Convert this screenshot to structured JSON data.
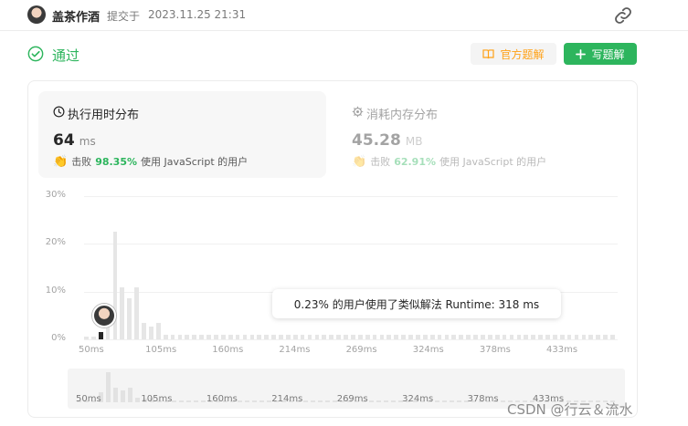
{
  "header": {
    "author": "盖茶作酒",
    "submit_label": "提交于",
    "submit_time": "2023.11.25 21:31"
  },
  "status": {
    "text": "通过",
    "color": "#2db55d"
  },
  "buttons": {
    "official_solution": "官方题解",
    "write_solution": "写题解"
  },
  "runtime": {
    "title": "执行用时分布",
    "value": "64",
    "unit": "ms",
    "beat_label": "击败",
    "beat_pct": "98.35%",
    "beat_suffix": "使用 JavaScript 的用户"
  },
  "memory": {
    "title": "消耗内存分布",
    "value": "45.28",
    "unit": "MB",
    "beat_label": "击败",
    "beat_pct": "62.91%",
    "beat_suffix": "使用 JavaScript 的用户"
  },
  "tooltip": "0.23% 的用户使用了类似解法 Runtime: 318 ms",
  "watermark": "CSDN @行云＆流水",
  "chart_data": {
    "type": "bar",
    "ylim": [
      0,
      30
    ],
    "y_ticks": [
      "30%",
      "20%",
      "10%",
      "0%"
    ],
    "x_ticks": [
      "50ms",
      "105ms",
      "160ms",
      "214ms",
      "269ms",
      "324ms",
      "378ms",
      "433ms"
    ],
    "mini_x_ticks": [
      "50ms",
      "105ms",
      "160ms",
      "214ms",
      "269ms",
      "324ms",
      "378ms",
      "433ms"
    ],
    "highlight_index": 2,
    "values": [
      0.6,
      0.6,
      1.5,
      7.5,
      22.5,
      10.8,
      8.6,
      10.8,
      3.5,
      2.6,
      3.4,
      0.9,
      0.9,
      0.9,
      0.9,
      0.9,
      0.9,
      0.9,
      0.9,
      0.9,
      0.9,
      0.9,
      0.9,
      0.9,
      0.9,
      0.9,
      0.9,
      0.9,
      0.9,
      0.9,
      0.9,
      0.9,
      0.9,
      0.9,
      0.9,
      0.9,
      0.9,
      0.9,
      0.9,
      0.9,
      0.9,
      0.9,
      0.9,
      0.9,
      0.9,
      0.9,
      0.9,
      0.9,
      0.9,
      0.9,
      0.9,
      0.9,
      0.9,
      0.9,
      0.9,
      0.9,
      0.9,
      0.9,
      0.9,
      0.9,
      0.9,
      0.9,
      0.9,
      0.9,
      0.9,
      0.9,
      0.9,
      0.9,
      0.9,
      0.9,
      0.9,
      0.9,
      0.9,
      0.9
    ],
    "colors": {
      "bar": "#e6e6e6",
      "highlight": "#262626"
    }
  }
}
